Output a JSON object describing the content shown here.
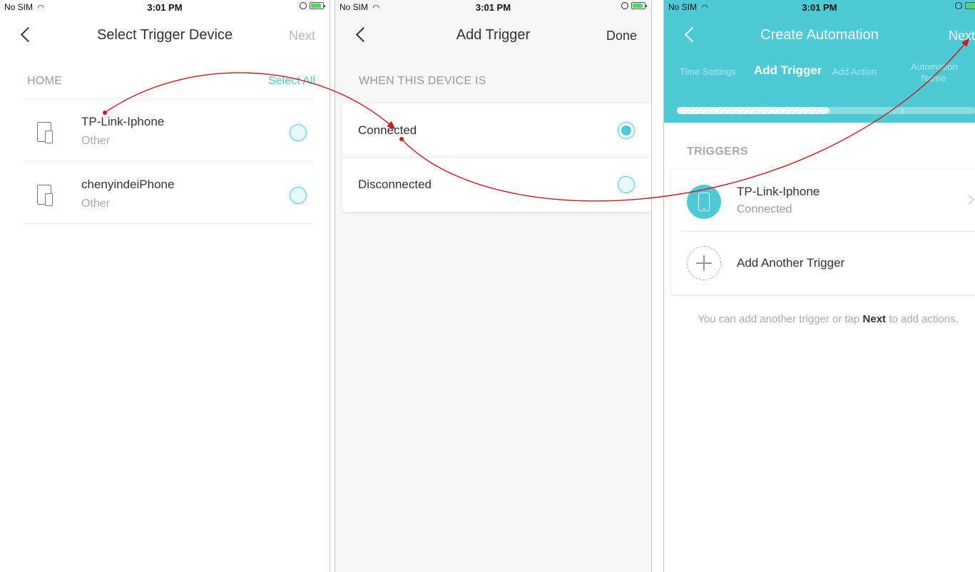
{
  "status_bar": {
    "carrier": "No SIM",
    "time": "3:01 PM"
  },
  "screen1": {
    "title": "Select Trigger Device",
    "next_label": "Next",
    "section": "HOME",
    "select_all": "Select All",
    "devices": [
      {
        "name": "TP-Link-Iphone",
        "type": "Other"
      },
      {
        "name": "chenyindeiPhone",
        "type": "Other"
      }
    ]
  },
  "screen2": {
    "title": "Add Trigger",
    "done_label": "Done",
    "section": "WHEN THIS DEVICE IS",
    "options": [
      {
        "label": "Connected",
        "selected": true
      },
      {
        "label": "Disconnected",
        "selected": false
      }
    ]
  },
  "screen3": {
    "title": "Create Automation",
    "next_label": "Next",
    "steps": [
      "Time Settings",
      "Add Trigger",
      "Add Action",
      "Automation Name"
    ],
    "active_step": "Add Trigger",
    "section": "TRIGGERS",
    "trigger": {
      "name": "TP-Link-Iphone",
      "state": "Connected"
    },
    "add_another": "Add Another Trigger",
    "hint_before": "You can add another trigger or tap ",
    "hint_bold": "Next",
    "hint_after": " to add actions."
  },
  "colors": {
    "accent": "#4ec9d6",
    "arrow": "#c41e1e"
  }
}
